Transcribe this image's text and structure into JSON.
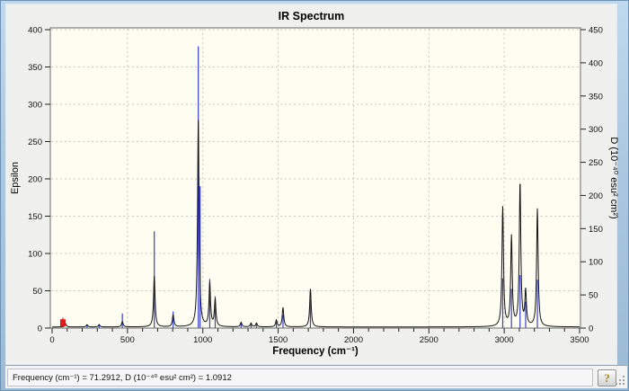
{
  "window": {
    "title": "IR Spectrum"
  },
  "colors": {
    "curve": "#141414",
    "sticks": "#3a3fd0",
    "marker": "#dd1d1d",
    "plot_background": "#fdfdf2",
    "grid": "#c9c9c3",
    "frame": "#6b6b6b",
    "tick": "#222222"
  },
  "status": {
    "readout": "Frequency (cm⁻¹) = 71.2912, D (10⁻⁴⁰ esu² cm²) = 1.0912",
    "help_label": "?"
  },
  "chart_data": {
    "type": "line",
    "subtype": "ir-spectrum-with-stick-overlay",
    "title": "IR Spectrum",
    "xlabel": "Frequency (cm⁻¹)",
    "ylabel_left": "Epsilon",
    "ylabel_right": "D (10⁻⁴⁰ esu² cm²)",
    "x_range": [
      0,
      3500
    ],
    "x_major_step": 500,
    "x_minor_step": 100,
    "yleft_range": [
      0,
      400
    ],
    "yright_range": [
      0,
      450
    ],
    "x_ticks": [
      0,
      500,
      1000,
      1500,
      2000,
      2500,
      3000,
      3500
    ],
    "yleft_ticks": [
      0,
      50,
      100,
      150,
      200,
      250,
      300,
      350,
      400
    ],
    "yright_ticks": [
      0,
      50,
      100,
      150,
      200,
      250,
      300,
      350,
      400,
      450
    ],
    "grid": "dashed",
    "baseline_epsilon": 1.5,
    "lorentzian_hwhm": 6,
    "series": [
      {
        "name": "Epsilon (broadened curve)",
        "axis": "left",
        "style": "curve",
        "color": "#141414"
      },
      {
        "name": "D sticks",
        "axis": "right",
        "style": "sticks",
        "color": "#3a3fd0"
      }
    ],
    "peaks": [
      {
        "frequency": 90,
        "epsilon": 4,
        "D": null
      },
      {
        "frequency": 232,
        "epsilon": 3,
        "D": 5
      },
      {
        "frequency": 312,
        "epsilon": 3,
        "D": 6
      },
      {
        "frequency": 466,
        "epsilon": 7,
        "D": 22
      },
      {
        "frequency": 678,
        "epsilon": 68,
        "D": 146
      },
      {
        "frequency": 803,
        "epsilon": 16,
        "D": 25
      },
      {
        "frequency": 970,
        "epsilon": 277,
        "D": 425
      },
      {
        "frequency": 982,
        "epsilon": null,
        "D": 214
      },
      {
        "frequency": 1046,
        "epsilon": 58,
        "D": 74
      },
      {
        "frequency": 1082,
        "epsilon": 36,
        "D": 48
      },
      {
        "frequency": 1254,
        "epsilon": 6,
        "D": 8
      },
      {
        "frequency": 1320,
        "epsilon": 5,
        "D": 6
      },
      {
        "frequency": 1356,
        "epsilon": 5,
        "D": 6
      },
      {
        "frequency": 1488,
        "epsilon": 9,
        "D": 10
      },
      {
        "frequency": 1532,
        "epsilon": 26,
        "D": 20
      },
      {
        "frequency": 1714,
        "epsilon": 51,
        "D": 43
      },
      {
        "frequency": 2990,
        "epsilon": 160,
        "D": 75
      },
      {
        "frequency": 3048,
        "epsilon": 120,
        "D": 59
      },
      {
        "frequency": 3105,
        "epsilon": 193,
        "D": 80
      },
      {
        "frequency": 3142,
        "epsilon": 46,
        "D": 40
      },
      {
        "frequency": 3220,
        "epsilon": 158,
        "D": 73
      }
    ],
    "cursor_marker": {
      "frequency": 71.2912,
      "D": 1.0912,
      "color": "#dd1d1d"
    }
  }
}
